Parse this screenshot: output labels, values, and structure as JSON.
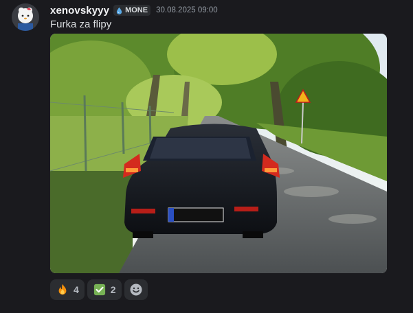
{
  "message": {
    "username": "xenovskyyy",
    "tag": "MONE",
    "timestamp": "30.08.2025 09:00",
    "text": "Furka za flipy"
  },
  "attachment": {
    "alt": "Furka za flipy"
  },
  "reactions": [
    {
      "emoji": "fire-emoji",
      "count": "4"
    },
    {
      "emoji": "check-mark-emoji",
      "count": "2"
    }
  ],
  "colors": {
    "background": "#1a1a1e",
    "username": "#f2f3f5",
    "timestamp": "#949ba4",
    "reaction_bg": "#2b2d31",
    "tag_icon": "#5aa9e6"
  }
}
